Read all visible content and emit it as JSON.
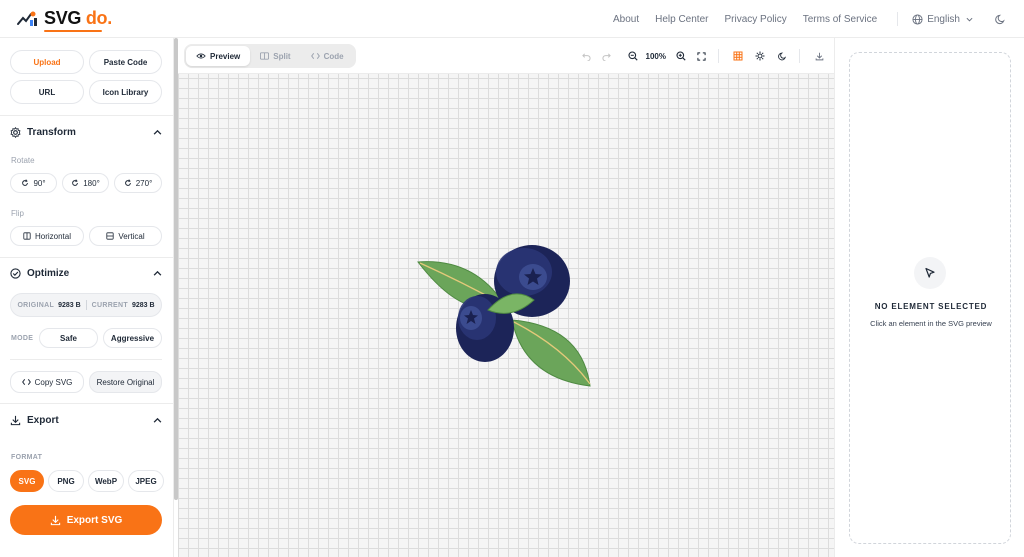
{
  "brand": {
    "name_main": "SVG",
    "name_accent": "do.",
    "accent_color": "#f97316"
  },
  "nav": {
    "links": [
      "About",
      "Help Center",
      "Privacy Policy",
      "Terms of Service"
    ],
    "language": "English"
  },
  "sidebar": {
    "source_buttons": {
      "upload": "Upload",
      "paste_code": "Paste Code",
      "url": "URL",
      "icon_library": "Icon Library"
    },
    "transform": {
      "title": "Transform",
      "rotate_label": "Rotate",
      "rotate_options": [
        "90°",
        "180°",
        "270°"
      ],
      "flip_label": "Flip",
      "flip_options": [
        "Horizontal",
        "Vertical"
      ]
    },
    "optimize": {
      "title": "Optimize",
      "original_label": "ORIGINAL",
      "original_value": "9283 B",
      "current_label": "CURRENT",
      "current_value": "9283 B",
      "mode_label": "MODE",
      "mode_safe": "Safe",
      "mode_aggressive": "Aggressive",
      "copy_svg": "Copy SVG",
      "restore_original": "Restore Original"
    },
    "export": {
      "title": "Export",
      "format_label": "FORMAT",
      "formats": [
        "SVG",
        "PNG",
        "WebP",
        "JPEG"
      ],
      "selected_format": "SVG",
      "export_button": "Export SVG"
    }
  },
  "toolbar": {
    "view_tabs": [
      "Preview",
      "Split",
      "Code"
    ],
    "active_tab": "Preview",
    "zoom": "100%"
  },
  "inspector": {
    "empty_title": "NO ELEMENT SELECTED",
    "empty_description": "Click an element in the SVG preview"
  }
}
